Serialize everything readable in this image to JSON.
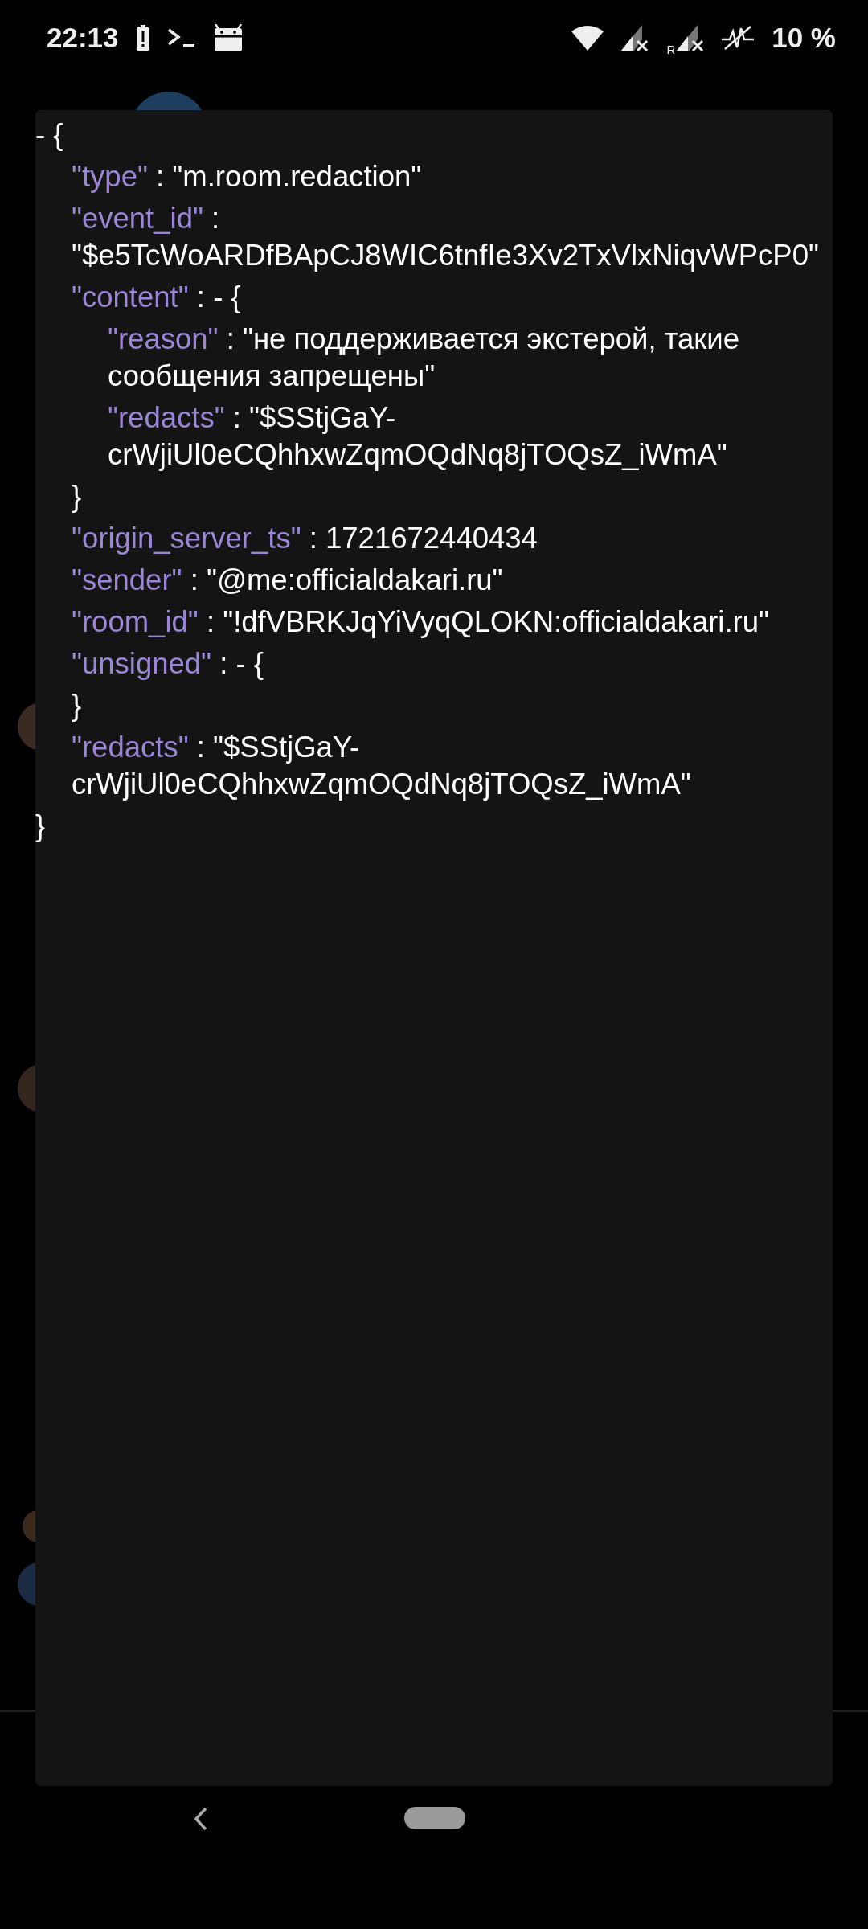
{
  "status_bar": {
    "time": "22:13",
    "roaming": "R",
    "battery": "10 %"
  },
  "event_viewer": {
    "separator": ":",
    "root": {
      "kind": "object",
      "toggle": "-",
      "open": "{",
      "close": "}",
      "children": [
        {
          "kind": "string",
          "key": "\"type\"",
          "value": "\"m.room.redaction\""
        },
        {
          "kind": "string",
          "key": "\"event_id\"",
          "value": "\"$e5TcWoARDfBApCJ8WIC6tnfIe3Xv2TxVlxNiqvWPcP0\""
        },
        {
          "kind": "object",
          "key": "\"content\"",
          "toggle": "-",
          "open": "{",
          "close": "}",
          "children": [
            {
              "kind": "string",
              "key": "\"reason\"",
              "value": "\"не поддерживается экстерой, такие сообщения запрещены\""
            },
            {
              "kind": "string",
              "key": "\"redacts\"",
              "value": "\"$SStjGaY-crWjiUl0eCQhhxwZqmOQdNq8jTOQsZ_iWmA\""
            }
          ]
        },
        {
          "kind": "number",
          "key": "\"origin_server_ts\"",
          "value": "1721672440434"
        },
        {
          "kind": "string",
          "key": "\"sender\"",
          "value": "\"@me:officialdakari.ru\""
        },
        {
          "kind": "string",
          "key": "\"room_id\"",
          "value": "\"!dfVBRKJqYiVyqQLOKN:officialdakari.ru\""
        },
        {
          "kind": "object",
          "key": "\"unsigned\"",
          "toggle": "-",
          "open": "{",
          "close": "}"
        },
        {
          "kind": "string",
          "key": "\"redacts\"",
          "value": "\"$SStjGaY-crWjiUl0eCQhhxwZqmOQdNq8jTOQsZ_iWmA\""
        }
      ]
    }
  }
}
